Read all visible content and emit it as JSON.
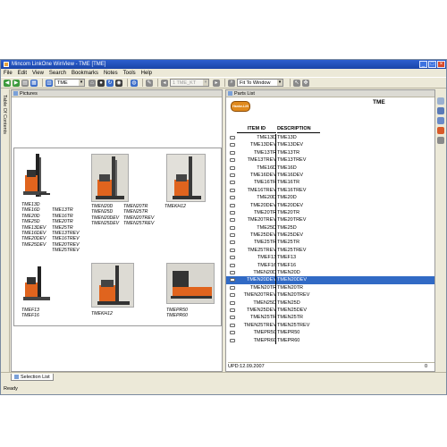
{
  "window": {
    "title": "Mincom LinkOne WinView - TME [TME]"
  },
  "menu": [
    "File",
    "Edit",
    "View",
    "Search",
    "Bookmarks",
    "Notes",
    "Tools",
    "Help"
  ],
  "toolbar": {
    "book_combo": "TME",
    "page_combo": "1 TME_KT",
    "zoom_combo": "Fit To Window"
  },
  "left_tab": {
    "label": "Table Of Contents"
  },
  "pictures": {
    "title": "Pictures",
    "thumbnails": [
      {
        "captions": [
          "TME13D",
          "TME16D",
          "TME20D",
          "TME25D",
          "TME13DEV",
          "TME16DEV",
          "TME20DEV",
          "TME25DEV"
        ],
        "captions2": [
          "TME13TR",
          "TME16TR",
          "TME20TR",
          "TME25TR",
          "TME13TREV",
          "TME16TREV",
          "TME20TREV",
          "TME25TREV"
        ]
      },
      {
        "captions": [
          "TMEN20D",
          "TMEN25D",
          "TMEN20DEV",
          "TMEN25DEV"
        ],
        "captions2": [
          "TMEN20TR",
          "TMEN25TR",
          "TMEN20TREV",
          "TMEN25TREV"
        ]
      },
      {
        "captions": [
          "TMEKH12"
        ]
      },
      {
        "captions": [
          "TMEF13",
          "TMEF16"
        ]
      },
      {
        "captions": [
          "TMEKH12"
        ]
      },
      {
        "captions": [
          "TMEPR50",
          "TMEPR60"
        ]
      }
    ]
  },
  "parts": {
    "title": "Parts List",
    "brand_logo": "Hanke-Lift",
    "heading": "TME",
    "col_item_id": "ITEM ID",
    "col_description": "DESCRIPTION",
    "rows": [
      [
        "TME13D",
        "TME13D"
      ],
      [
        "TME13DEV",
        "TME13DEV"
      ],
      [
        "TME13TR",
        "TME13TR"
      ],
      [
        "TME13TREV",
        "TME13TREV"
      ],
      [
        "TME16D",
        "TME16D"
      ],
      [
        "TME16DEV",
        "TME16DEV"
      ],
      [
        "TME16TR",
        "TME16TR"
      ],
      [
        "TME16TREV",
        "TME16TREV"
      ],
      [
        "TME20D",
        "TME20D"
      ],
      [
        "TME20DEV",
        "TME20DEV"
      ],
      [
        "TME20TR",
        "TME20TR"
      ],
      [
        "TME20TREV",
        "TME20TREV"
      ],
      [
        "TME25D",
        "TME25D"
      ],
      [
        "TME25DEV",
        "TME25DEV"
      ],
      [
        "TME25TR",
        "TME25TR"
      ],
      [
        "TME25TREV",
        "TME25TREV"
      ],
      [
        "TMEF13",
        "TMEF13"
      ],
      [
        "TMEF16",
        "TMEF16"
      ],
      [
        "TMEN20D",
        "TMEN20D"
      ],
      [
        "TMEN20DEV",
        "TMEN20DEV"
      ],
      [
        "TMEN20TR",
        "TMEN20TR"
      ],
      [
        "TMEN20TREV",
        "TMEN20TREV"
      ],
      [
        "TMEN25D",
        "TMEN25D"
      ],
      [
        "TMEN25DEV",
        "TMEN25DEV"
      ],
      [
        "TMEN25TR",
        "TMEN25TR"
      ],
      [
        "TMEN25TREV",
        "TMEN25TREV"
      ],
      [
        "TMEPR50",
        "TMEPR50"
      ],
      [
        "TMEPR60",
        "TMEPR60"
      ]
    ],
    "selected_index": 19,
    "footer_update": "UPD:12.09.2007",
    "footer_count": "0"
  },
  "bottom_tab": {
    "label": "Selection List"
  },
  "status": {
    "text": "Ready"
  },
  "colors": {
    "selection": "#316ac5",
    "machine_orange": "#e0641e",
    "titlebar": "#2c5fcf"
  }
}
